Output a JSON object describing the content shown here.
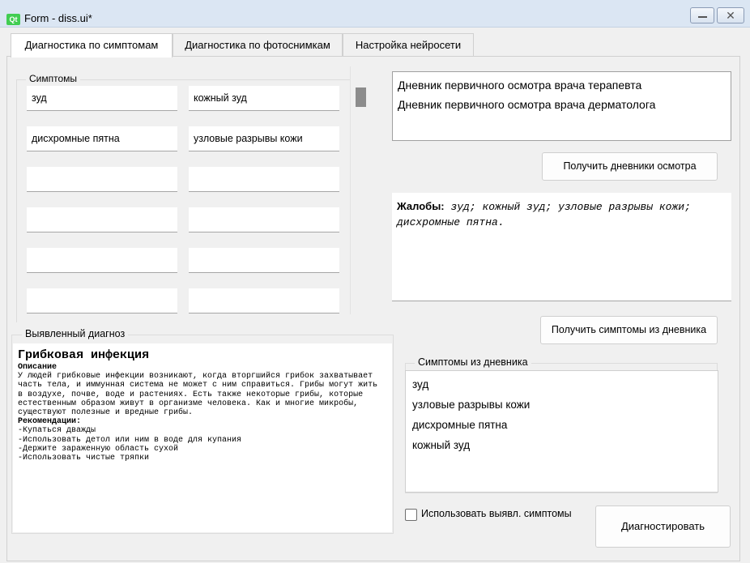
{
  "window": {
    "logo_text": "Qt",
    "title": "Form - diss.ui*",
    "minimize_glyph": "—",
    "close_glyph": "✕"
  },
  "tabs": [
    {
      "label": "Диагностика по симптомам",
      "active": true
    },
    {
      "label": "Диагностика по фотоснимкам",
      "active": false
    },
    {
      "label": "Настройка нейросети",
      "active": false
    }
  ],
  "symptoms_group": {
    "title": "Симптомы",
    "fields": [
      "зуд",
      "кожный зуд",
      "дисхромные пятна",
      "узловые разрывы кожи",
      "",
      "",
      "",
      "",
      "",
      "",
      "",
      ""
    ]
  },
  "diagnosis_group": {
    "title": "Выявленный диагноз",
    "heading": "Грибковая инфекция",
    "description_label": "Описание",
    "description": "У людей грибковые инфекции возникают, когда вторгшийся грибок захватывает часть тела, и иммунная система не может с ним справиться. Грибы могут жить в воздухе, почве, воде и растениях. Есть также некоторые грибы, которые естественным образом живут в организме человека. Как и многие микробы, существуют полезные и вредные грибы.",
    "recommendations_label": "Рекомендации:",
    "recommendations": [
      "-Купаться дважды",
      "-Использовать детол или ним в воде для купания",
      "-Держите зараженную область сухой",
      "-Использовать чистые тряпки"
    ]
  },
  "journals": {
    "items": [
      "Дневник первичного осмотра врача терапевта",
      "Дневник первичного осмотра врача дерматолога"
    ],
    "button_label": "Получить дневники осмотра"
  },
  "complaints": {
    "label": "Жалобы:",
    "text": " зуд; кожный зуд; узловые разрывы кожи; дисхромные пятна."
  },
  "get_symptoms_button_label": "Получить симптомы из дневника",
  "symptoms_from_journal": {
    "title": "Симптомы из дневника",
    "items": [
      "зуд",
      "узловые разрывы кожи",
      "дисхромные пятна",
      "кожный зуд"
    ]
  },
  "use_detected_checkbox": {
    "label": "Использовать выявл. симптомы",
    "checked": false
  },
  "diagnose_button_label": "Диагностировать",
  "colors": {
    "qt_green": "#41cd52",
    "titlebar": "#dbe6f3",
    "window_bg": "#f0f0f0"
  }
}
